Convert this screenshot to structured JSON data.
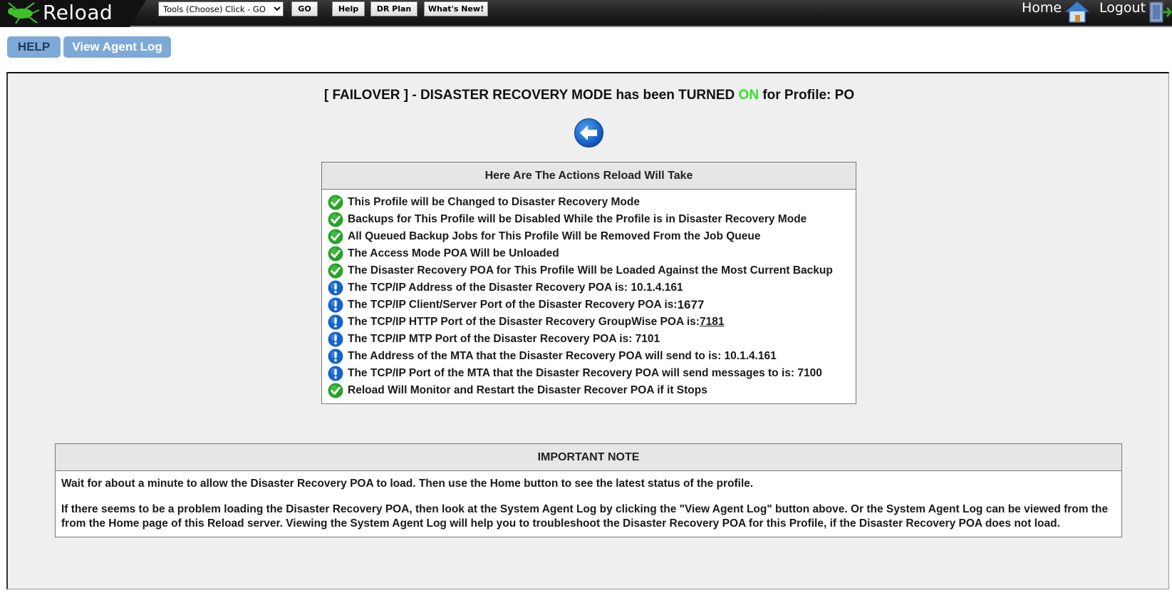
{
  "app": {
    "name": "Reload",
    "tools_select": {
      "value": "Tools (Choose) Click - GO",
      "options": [
        "Tools (Choose) Click - GO"
      ]
    },
    "buttons": {
      "go": "GO",
      "help": "Help",
      "dr_plan": "DR Plan",
      "whats_new": "What's New!"
    },
    "home": "Home",
    "logout": "Logout"
  },
  "subnav": {
    "help": "HELP",
    "view_agent_log": "View Agent Log"
  },
  "title": {
    "prefix": "[ FAILOVER ] - DISASTER RECOVERY MODE has been TURNED ",
    "state": "ON",
    "suffix": " for Profile: PO",
    "state_color": "#33e12a"
  },
  "actions": {
    "heading": "Here Are The Actions Reload Will Take",
    "items": [
      {
        "icon": "check",
        "text": "This Profile will be Changed to Disaster Recovery Mode"
      },
      {
        "icon": "check",
        "text": "Backups for This Profile will be Disabled While the Profile is in Disaster Recovery Mode"
      },
      {
        "icon": "check",
        "text": "All Queued Backup Jobs for This Profile Will be Removed From the Job Queue"
      },
      {
        "icon": "check",
        "text": "The Access Mode POA Will be Unloaded"
      },
      {
        "icon": "check",
        "text": "The Disaster Recovery POA for This Profile Will be Loaded Against the Most Current Backup"
      },
      {
        "icon": "info",
        "text": "The TCP/IP Address of the Disaster Recovery POA is: 10.1.4.161"
      },
      {
        "icon": "info",
        "text": "The TCP/IP Client/Server Port of the Disaster Recovery POA is: ",
        "value": "1677"
      },
      {
        "icon": "info",
        "text": "The TCP/IP HTTP Port of the Disaster Recovery GroupWise POA is: ",
        "link": "7181"
      },
      {
        "icon": "info",
        "text": "The TCP/IP MTP Port of the Disaster Recovery POA is: 7101"
      },
      {
        "icon": "info",
        "text": "The Address of the MTA that the Disaster Recovery POA will send to is: 10.1.4.161"
      },
      {
        "icon": "info",
        "text": "The TCP/IP Port of the MTA that the Disaster Recovery POA will send messages to is: 7100"
      },
      {
        "icon": "check",
        "text": "Reload Will Monitor and Restart the Disaster Recover POA if it Stops"
      }
    ]
  },
  "note": {
    "heading": "IMPORTANT NOTE",
    "paragraphs": [
      "Wait for about a minute to allow the Disaster Recovery POA to load. Then use the Home button to see the latest status of the profile.",
      "If there seems to be a problem loading the Disaster Recovery POA, then look at the System Agent Log by clicking the \"View Agent Log\" button above. Or the System Agent Log can be viewed from the from the Home page of this Reload server. Viewing the System Agent Log will help you to troubleshoot the Disaster Recovery POA for this Profile, if the Disaster Recovery POA does not load."
    ]
  },
  "colors": {
    "check": "#27a327",
    "info": "#1463c8",
    "pill": "#7ea9d6"
  }
}
